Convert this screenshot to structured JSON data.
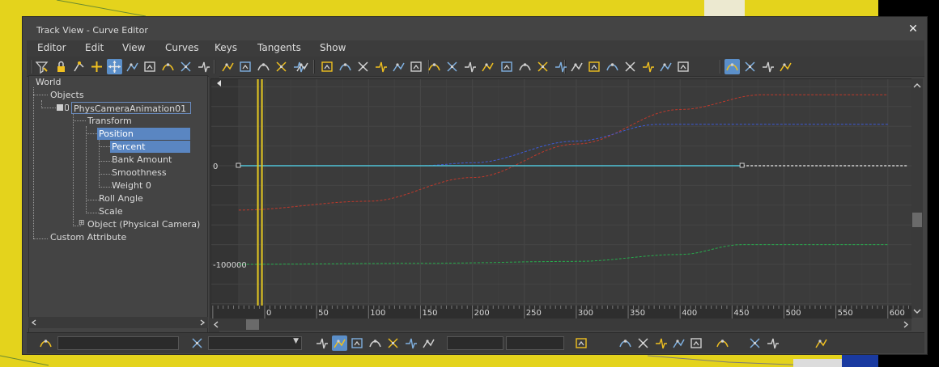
{
  "window": {
    "title": "Track View - Curve Editor",
    "close_symbol": "✕"
  },
  "menu": [
    "Editor",
    "Edit",
    "View",
    "Curves",
    "Keys",
    "Tangents",
    "Show"
  ],
  "toolbar_icons": [
    "filter-icon",
    "lock-icon",
    "snap-frames-icon",
    "add-keys-icon",
    "move-keys-icon",
    "slide-keys-icon",
    "scale-keys-icon",
    "scale-values-icon",
    "region-tool-icon",
    "retime-tool-icon",
    "key-tool-a-icon",
    "key-tool-b-icon",
    "key-tool-c-icon",
    "key-tool-d-icon",
    "key-tool-e-icon",
    "pointer-icon",
    "select-keys-icon",
    "draw-curves-icon",
    "reduce-keys-icon",
    "break-tangents-icon",
    "unify-tangents-icon",
    "tangent-auto-icon",
    "tangent-spline-icon",
    "tangent-fast-icon",
    "tangent-slow-icon",
    "tangent-step-icon",
    "tangent-linear-icon",
    "tangent-smooth-icon",
    "params-curve-out-of-range-icon",
    "curve-type-a-icon",
    "curve-type-b-icon",
    "curve-type-c-icon",
    "curve-type-d-icon",
    "curve-type-e-icon",
    "curve-type-f-icon",
    "curve-type-g-icon",
    "curve-type-h-icon",
    "show-keyable-icon",
    "show-all-tangents-icon",
    "show-tangents-icon",
    "lock-selection-icon"
  ],
  "tree": {
    "items": [
      {
        "label": "World",
        "level": 0
      },
      {
        "label": "Objects",
        "level": 1
      },
      {
        "label": "PhysCameraAnimation01",
        "level": 2
      },
      {
        "label": "Transform",
        "level": 3
      },
      {
        "label": "Position",
        "level": 4
      },
      {
        "label": "Percent",
        "level": 5
      },
      {
        "label": "Bank Amount",
        "level": 5
      },
      {
        "label": "Smoothness",
        "level": 5
      },
      {
        "label": "Weight 0",
        "level": 5
      },
      {
        "label": "Roll Angle",
        "level": 4
      },
      {
        "label": "Scale",
        "level": 4
      },
      {
        "label": "Object (Physical Camera)",
        "level": 3
      },
      {
        "label": "Custom Attribute",
        "level": 1
      }
    ],
    "selected": [
      "Position",
      "Percent"
    ],
    "expander_symbol": "⊞"
  },
  "graph": {
    "value_labels": [
      "0",
      "-100000"
    ],
    "frame_labels": [
      "0",
      "50",
      "100",
      "150",
      "200",
      "250",
      "300",
      "350",
      "400",
      "450",
      "500",
      "550",
      "600"
    ],
    "current_frame": -5,
    "curve_colors": {
      "x": "#c0392b",
      "y": "#27ae4d",
      "z": "#3d5bd8",
      "percent": "#4fc3d8"
    },
    "curves": {
      "x": [
        [
          -25,
          -45000
        ],
        [
          100,
          -36000
        ],
        [
          200,
          -12000
        ],
        [
          300,
          22000
        ],
        [
          400,
          57000
        ],
        [
          480,
          72000
        ],
        [
          600,
          72000
        ]
      ],
      "y": [
        [
          -25,
          -100000
        ],
        [
          150,
          -99000
        ],
        [
          300,
          -97000
        ],
        [
          400,
          -90000
        ],
        [
          460,
          -80000
        ],
        [
          600,
          -80000
        ]
      ],
      "z": [
        [
          -25,
          0
        ],
        [
          150,
          0
        ],
        [
          200,
          3000
        ],
        [
          300,
          25000
        ],
        [
          380,
          42000
        ],
        [
          460,
          42000
        ],
        [
          600,
          42000
        ]
      ],
      "percent": [
        [
          -25,
          0
        ],
        [
          600,
          0
        ]
      ]
    }
  },
  "status": {
    "fields": [
      "",
      "",
      "",
      ""
    ]
  },
  "status_icons": [
    "zoom-selected-icon",
    "filter-list-icon",
    "key-stats-icon",
    "show-selected-key-stats-icon",
    "track-sets-icon",
    "track-sets-b-icon",
    "pin-icon",
    "lock-current-icon",
    "edit-key-icon",
    "frame-all-icon",
    "frame-horizontal-icon",
    "frame-value-icon",
    "frame-extents-icon",
    "pan-icon",
    "frame-values-icon",
    "zoom-values-icon",
    "zoom-region-icon",
    "zoom-icon",
    "zoom-region-b-icon"
  ]
}
